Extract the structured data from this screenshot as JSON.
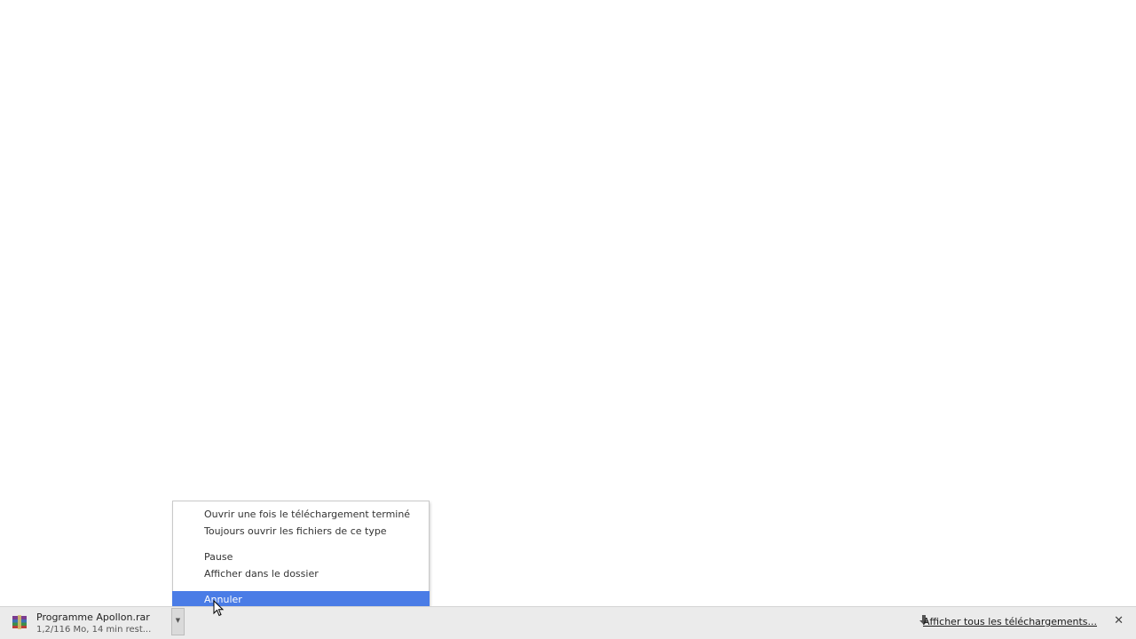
{
  "context_menu": {
    "items": [
      {
        "label": "Ouvrir une fois le téléchargement terminé"
      },
      {
        "label": "Toujours ouvrir les fichiers de ce type"
      },
      {
        "label": "Pause"
      },
      {
        "label": "Afficher dans le dossier"
      },
      {
        "label": "Annuler",
        "highlighted": true
      }
    ]
  },
  "download_shelf": {
    "item": {
      "file_name": "Programme Apollon.rar",
      "status": "1,2/116 Mo, 14 min rest...",
      "icon": "winrar-archive-icon"
    },
    "show_all_label": "Afficher tous les téléchargements...",
    "close_label": "✕"
  },
  "colors": {
    "highlight": "#4a7ce6",
    "shelf_bg": "#ebebeb"
  }
}
